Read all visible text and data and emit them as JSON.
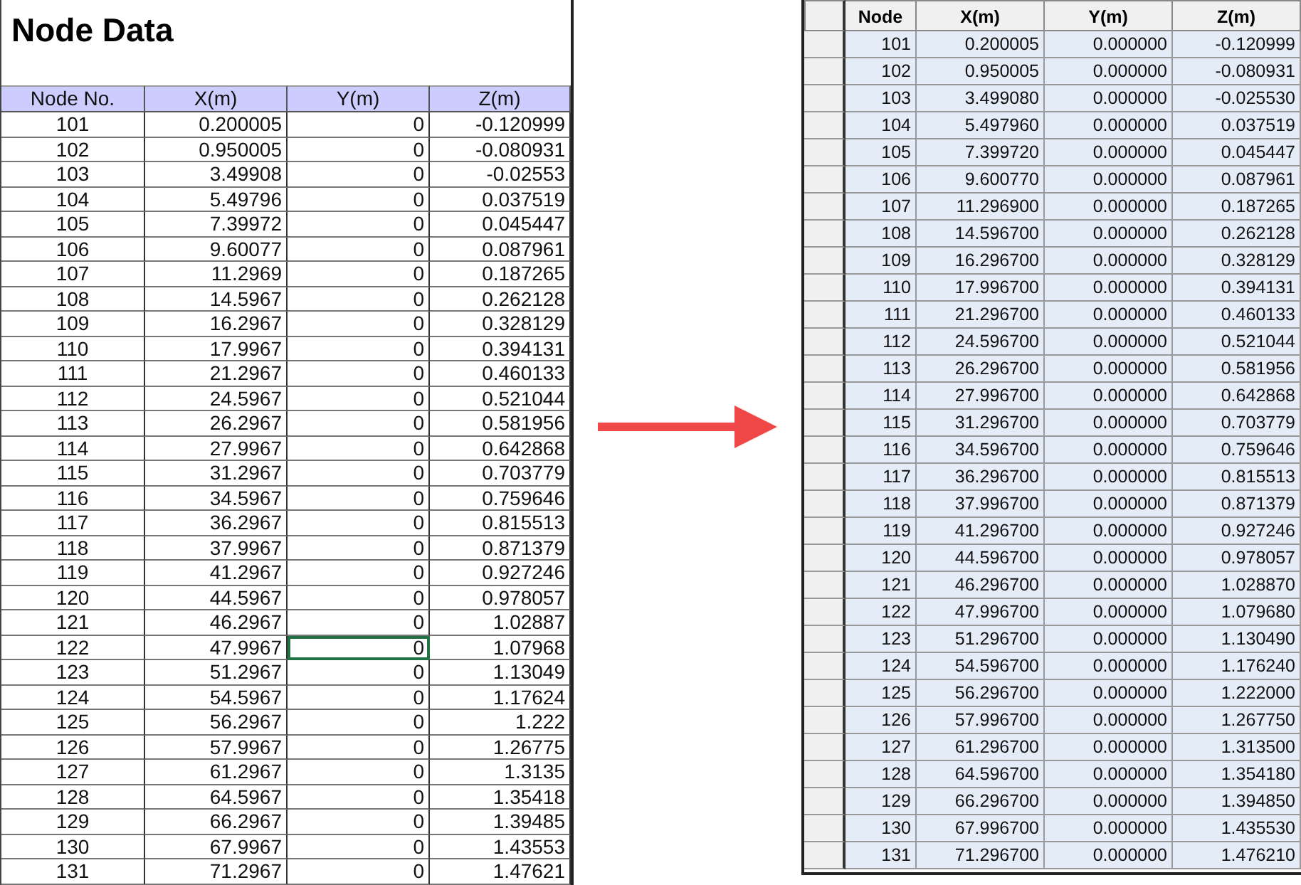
{
  "spreadsheet": {
    "title": "Node Data",
    "columns": [
      "Node No.",
      "X(m)",
      "Y(m)",
      "Z(m)"
    ],
    "rows": [
      {
        "cells": [
          "101",
          "0.200005",
          "0",
          "-0.120999"
        ],
        "selected": false
      },
      {
        "cells": [
          "102",
          "0.950005",
          "0",
          "-0.080931"
        ],
        "selected": false
      },
      {
        "cells": [
          "103",
          "3.49908",
          "0",
          "-0.02553"
        ],
        "selected": false
      },
      {
        "cells": [
          "104",
          "5.49796",
          "0",
          "0.037519"
        ],
        "selected": false
      },
      {
        "cells": [
          "105",
          "7.39972",
          "0",
          "0.045447"
        ],
        "selected": false
      },
      {
        "cells": [
          "106",
          "9.60077",
          "0",
          "0.087961"
        ],
        "selected": false
      },
      {
        "cells": [
          "107",
          "11.2969",
          "0",
          "0.187265"
        ],
        "selected": false
      },
      {
        "cells": [
          "108",
          "14.5967",
          "0",
          "0.262128"
        ],
        "selected": false
      },
      {
        "cells": [
          "109",
          "16.2967",
          "0",
          "0.328129"
        ],
        "selected": false
      },
      {
        "cells": [
          "110",
          "17.9967",
          "0",
          "0.394131"
        ],
        "selected": false
      },
      {
        "cells": [
          "111",
          "21.2967",
          "0",
          "0.460133"
        ],
        "selected": false
      },
      {
        "cells": [
          "112",
          "24.5967",
          "0",
          "0.521044"
        ],
        "selected": false
      },
      {
        "cells": [
          "113",
          "26.2967",
          "0",
          "0.581956"
        ],
        "selected": false
      },
      {
        "cells": [
          "114",
          "27.9967",
          "0",
          "0.642868"
        ],
        "selected": false
      },
      {
        "cells": [
          "115",
          "31.2967",
          "0",
          "0.703779"
        ],
        "selected": false
      },
      {
        "cells": [
          "116",
          "34.5967",
          "0",
          "0.759646"
        ],
        "selected": false
      },
      {
        "cells": [
          "117",
          "36.2967",
          "0",
          "0.815513"
        ],
        "selected": false
      },
      {
        "cells": [
          "118",
          "37.9967",
          "0",
          "0.871379"
        ],
        "selected": false
      },
      {
        "cells": [
          "119",
          "41.2967",
          "0",
          "0.927246"
        ],
        "selected": false
      },
      {
        "cells": [
          "120",
          "44.5967",
          "0",
          "0.978057"
        ],
        "selected": false
      },
      {
        "cells": [
          "121",
          "46.2967",
          "0",
          "1.02887"
        ],
        "selected": false
      },
      {
        "cells": [
          "122",
          "47.9967",
          "0",
          "1.07968"
        ],
        "selected": true
      },
      {
        "cells": [
          "123",
          "51.2967",
          "0",
          "1.13049"
        ],
        "selected": false
      },
      {
        "cells": [
          "124",
          "54.5967",
          "0",
          "1.17624"
        ],
        "selected": false
      },
      {
        "cells": [
          "125",
          "56.2967",
          "0",
          "1.222"
        ],
        "selected": false
      },
      {
        "cells": [
          "126",
          "57.9967",
          "0",
          "1.26775"
        ],
        "selected": false
      },
      {
        "cells": [
          "127",
          "61.2967",
          "0",
          "1.3135"
        ],
        "selected": false
      },
      {
        "cells": [
          "128",
          "64.5967",
          "0",
          "1.35418"
        ],
        "selected": false
      },
      {
        "cells": [
          "129",
          "66.2967",
          "0",
          "1.39485"
        ],
        "selected": false
      },
      {
        "cells": [
          "130",
          "67.9967",
          "0",
          "1.43553"
        ],
        "selected": false
      },
      {
        "cells": [
          "131",
          "71.2967",
          "0",
          "1.47621"
        ],
        "selected": false
      }
    ]
  },
  "grid": {
    "columns": [
      "Node",
      "X(m)",
      "Y(m)",
      "Z(m)"
    ],
    "rows": [
      [
        "101",
        "0.200005",
        "0.000000",
        "-0.120999"
      ],
      [
        "102",
        "0.950005",
        "0.000000",
        "-0.080931"
      ],
      [
        "103",
        "3.499080",
        "0.000000",
        "-0.025530"
      ],
      [
        "104",
        "5.497960",
        "0.000000",
        "0.037519"
      ],
      [
        "105",
        "7.399720",
        "0.000000",
        "0.045447"
      ],
      [
        "106",
        "9.600770",
        "0.000000",
        "0.087961"
      ],
      [
        "107",
        "11.296900",
        "0.000000",
        "0.187265"
      ],
      [
        "108",
        "14.596700",
        "0.000000",
        "0.262128"
      ],
      [
        "109",
        "16.296700",
        "0.000000",
        "0.328129"
      ],
      [
        "110",
        "17.996700",
        "0.000000",
        "0.394131"
      ],
      [
        "111",
        "21.296700",
        "0.000000",
        "0.460133"
      ],
      [
        "112",
        "24.596700",
        "0.000000",
        "0.521044"
      ],
      [
        "113",
        "26.296700",
        "0.000000",
        "0.581956"
      ],
      [
        "114",
        "27.996700",
        "0.000000",
        "0.642868"
      ],
      [
        "115",
        "31.296700",
        "0.000000",
        "0.703779"
      ],
      [
        "116",
        "34.596700",
        "0.000000",
        "0.759646"
      ],
      [
        "117",
        "36.296700",
        "0.000000",
        "0.815513"
      ],
      [
        "118",
        "37.996700",
        "0.000000",
        "0.871379"
      ],
      [
        "119",
        "41.296700",
        "0.000000",
        "0.927246"
      ],
      [
        "120",
        "44.596700",
        "0.000000",
        "0.978057"
      ],
      [
        "121",
        "46.296700",
        "0.000000",
        "1.028870"
      ],
      [
        "122",
        "47.996700",
        "0.000000",
        "1.079680"
      ],
      [
        "123",
        "51.296700",
        "0.000000",
        "1.130490"
      ],
      [
        "124",
        "54.596700",
        "0.000000",
        "1.176240"
      ],
      [
        "125",
        "56.296700",
        "0.000000",
        "1.222000"
      ],
      [
        "126",
        "57.996700",
        "0.000000",
        "1.267750"
      ],
      [
        "127",
        "61.296700",
        "0.000000",
        "1.313500"
      ],
      [
        "128",
        "64.596700",
        "0.000000",
        "1.354180"
      ],
      [
        "129",
        "66.296700",
        "0.000000",
        "1.394850"
      ],
      [
        "130",
        "67.996700",
        "0.000000",
        "1.435530"
      ],
      [
        "131",
        "71.296700",
        "0.000000",
        "1.476210"
      ]
    ]
  }
}
